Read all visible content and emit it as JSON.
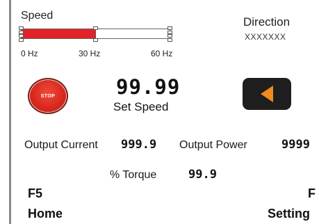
{
  "speed": {
    "label": "Speed",
    "fill_fraction": 0.5,
    "ticks": [
      "0 Hz",
      "30 Hz",
      "60 Hz"
    ]
  },
  "direction": {
    "label": "Direction",
    "value": "XXXXXXX"
  },
  "stop_button": {
    "label": "STOP",
    "color": "#e32228"
  },
  "set_speed": {
    "value": "99.99",
    "label": "Set Speed"
  },
  "direction_button": {
    "icon": "arrow-left-icon",
    "arrow_color": "#f08a1c"
  },
  "readouts": {
    "output_current_label": "Output Current",
    "output_current_value": "999.9",
    "output_power_label": "Output Power",
    "output_power_value": "9999",
    "torque_label": "% Torque",
    "torque_value": "99.9"
  },
  "footer": {
    "left_key": "F5",
    "left_label": "Home",
    "right_key": "F",
    "right_label": "Setting"
  }
}
